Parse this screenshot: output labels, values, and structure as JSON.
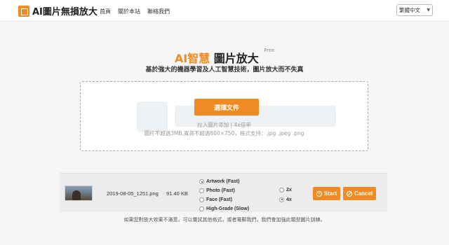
{
  "header": {
    "logo_text": "AI圖片無損放大",
    "nav": [
      "首頁",
      "關於本站",
      "聯絡我們"
    ],
    "language": "繁體中文"
  },
  "hero": {
    "title_accent": "AI智慧",
    "title_rest": "圖片放大",
    "free_badge": "Free",
    "subtitle": "基於強大的機器學習及人工智慧技術，圖片放大而不失真"
  },
  "dropzone": {
    "select_button": "選擇文件",
    "hint": "拉入圖片添加 | 4x倍率",
    "rules": "圖片不超過3MB,寬高不超過800×750，格式支持：.jpg .jpeg .png"
  },
  "file": {
    "name": "2019-08-05_1251.png",
    "size": "91.40 KB",
    "modes": [
      {
        "label": "Artwork (Fast)",
        "selected": true
      },
      {
        "label": "Photo (Fast)",
        "selected": false
      },
      {
        "label": "Face (Fast)",
        "selected": false
      },
      {
        "label": "High-Grade (Slow)",
        "selected": false
      }
    ],
    "scales": [
      {
        "label": "2x",
        "selected": false
      },
      {
        "label": "4x",
        "selected": true
      }
    ],
    "start_label": "Start",
    "cancel_label": "Cancel"
  },
  "footer_note": "如果您對放大效果不滿意，可以嘗試其他格式，或者電郵我們，我們會加強此類型圖片訓練。",
  "colors": {
    "accent": "#f08a24"
  }
}
